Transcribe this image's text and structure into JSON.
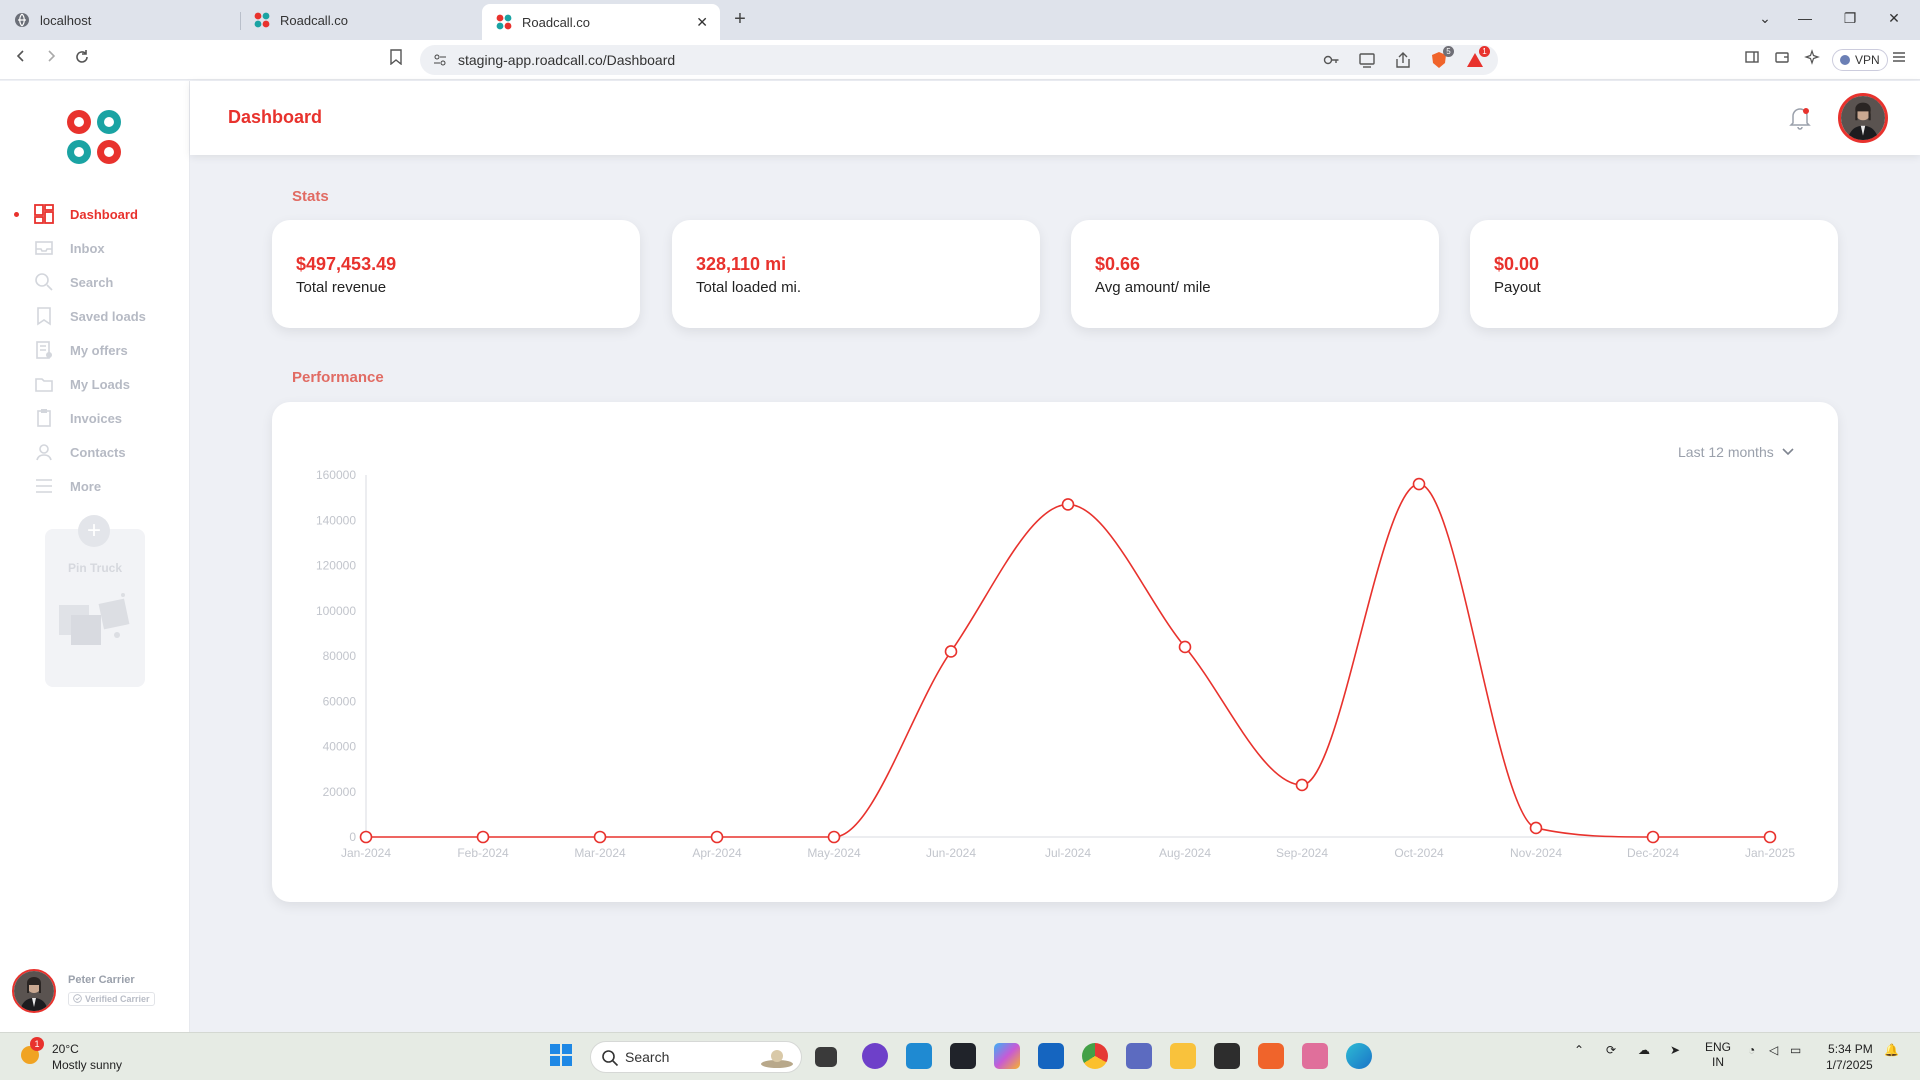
{
  "browser": {
    "tabs": [
      {
        "title": "localhost"
      },
      {
        "title": "Roadcall.co"
      },
      {
        "title": "Roadcall.co",
        "active": true
      }
    ],
    "url": "staging-app.roadcall.co/Dashboard",
    "vpn_label": "VPN",
    "brave_badge": "5",
    "rewards_badge": "1"
  },
  "sidebar": {
    "items": [
      {
        "label": "Dashboard",
        "icon": "dashboard-icon",
        "active": true
      },
      {
        "label": "Inbox",
        "icon": "inbox-icon"
      },
      {
        "label": "Search",
        "icon": "search-icon"
      },
      {
        "label": "Saved loads",
        "icon": "bookmark-icon"
      },
      {
        "label": "My offers",
        "icon": "offers-icon"
      },
      {
        "label": "My Loads",
        "icon": "folder-icon"
      },
      {
        "label": "Invoices",
        "icon": "clipboard-icon"
      },
      {
        "label": "Contacts",
        "icon": "user-icon"
      },
      {
        "label": "More",
        "icon": "menu-icon"
      }
    ],
    "pin_truck_label": "Pin Truck",
    "user": {
      "name": "Peter Carrier",
      "badge": "Verified Carrier"
    }
  },
  "header": {
    "title": "Dashboard"
  },
  "stats": {
    "title": "Stats",
    "cards": [
      {
        "value": "$497,453.49",
        "label": "Total revenue"
      },
      {
        "value": "328,110 mi",
        "label": "Total loaded mi."
      },
      {
        "value": "$0.66",
        "label": "Avg amount/ mile"
      },
      {
        "value": "$0.00",
        "label": "Payout"
      }
    ]
  },
  "performance": {
    "title": "Performance",
    "range_selector": "Last 12 months"
  },
  "colors": {
    "accent": "#e8322d",
    "teal": "#1aa3a3",
    "section_title": "#e16b63"
  },
  "chart_data": {
    "type": "line",
    "title": "",
    "xlabel": "",
    "ylabel": "",
    "categories": [
      "Jan-2024",
      "Feb-2024",
      "Mar-2024",
      "Apr-2024",
      "May-2024",
      "Jun-2024",
      "Jul-2024",
      "Aug-2024",
      "Sep-2024",
      "Oct-2024",
      "Nov-2024",
      "Dec-2024",
      "Jan-2025"
    ],
    "series": [
      {
        "values": [
          0,
          0,
          0,
          0,
          0,
          82000,
          147000,
          84000,
          23000,
          156000,
          4000,
          0,
          0
        ]
      }
    ],
    "ylim": [
      0,
      160000
    ],
    "yticks": [
      0,
      20000,
      40000,
      60000,
      80000,
      100000,
      120000,
      140000,
      160000
    ],
    "grid": false,
    "legend": "none"
  },
  "taskbar": {
    "weather_temp": "20°C",
    "weather_desc": "Mostly sunny",
    "weather_badge": "1",
    "search_placeholder": "Search",
    "lang_top": "ENG",
    "lang_bottom": "IN",
    "time": "5:34 PM",
    "date": "1/7/2025"
  }
}
